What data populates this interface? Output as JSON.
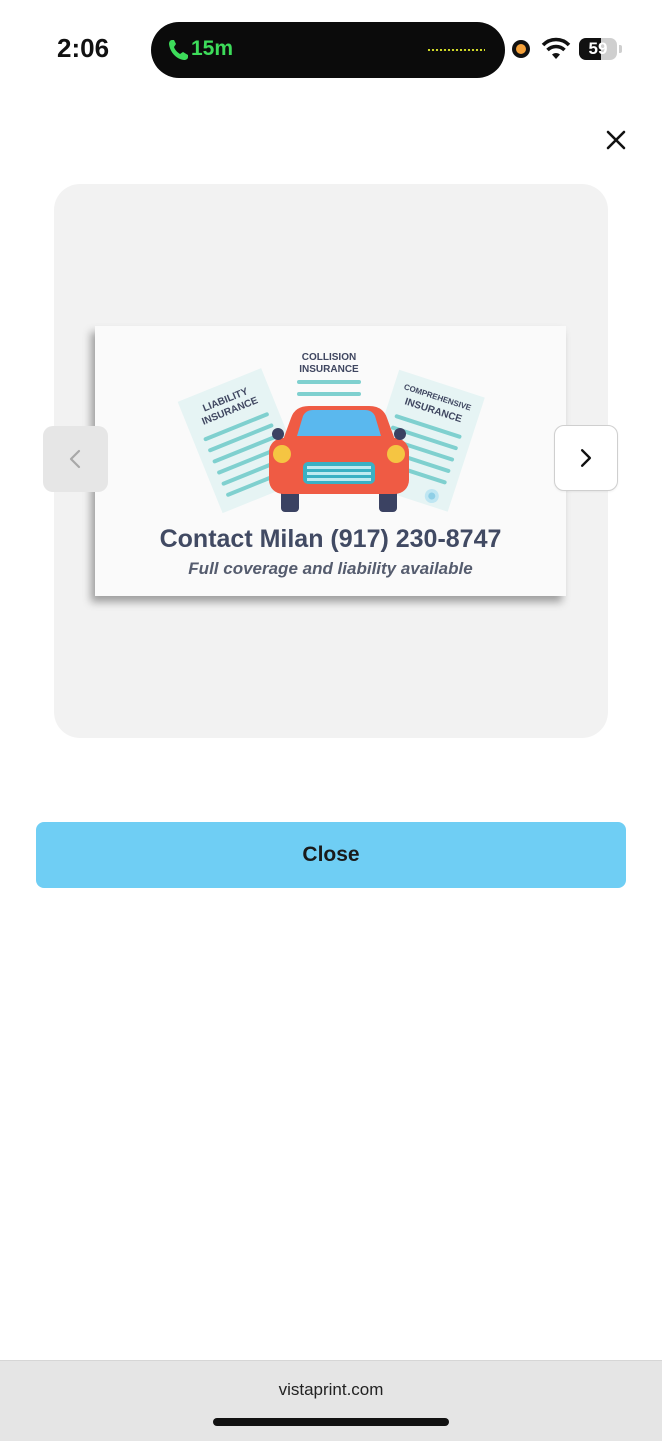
{
  "status_bar": {
    "time": "2:06",
    "call_duration": "15m",
    "battery_level": "59",
    "battery_fraction": 0.59,
    "call_color": "#3ddc5a"
  },
  "modal": {
    "close_icon": "close-icon",
    "prev_icon": "chevron-left-icon",
    "next_icon": "chevron-right-icon",
    "close_button_label": "Close",
    "close_button_color": "#6fcef4"
  },
  "card": {
    "title": "Contact Milan (917) 230-8747",
    "subtitle": "Full coverage and liability available",
    "doc_left_label_1": "LIABILITY",
    "doc_left_label_2": "INSURANCE",
    "doc_center_label_1": "COLLISION",
    "doc_center_label_2": "INSURANCE",
    "doc_right_label_1": "COMPREHENSIVE",
    "doc_right_label_2": "INSURANCE"
  },
  "browser": {
    "url": "vistaprint.com"
  }
}
